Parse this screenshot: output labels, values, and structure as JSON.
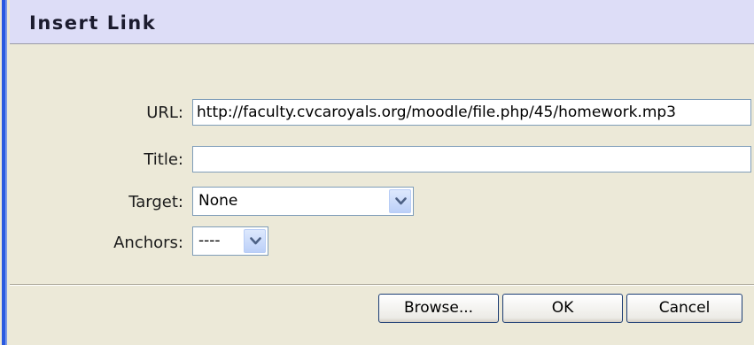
{
  "dialog": {
    "title": "Insert Link"
  },
  "form": {
    "url_label": "URL:",
    "url_value": "http://faculty.cvcaroyals.org/moodle/file.php/45/homework.mp3",
    "title_label": "Title:",
    "title_value": "",
    "target_label": "Target:",
    "target_value": "None",
    "anchors_label": "Anchors:",
    "anchors_value": "----"
  },
  "buttons": {
    "browse": "Browse...",
    "ok": "OK",
    "cancel": "Cancel"
  },
  "colors": {
    "title_bar": "#ddddf7",
    "dialog_bg": "#ece9d8",
    "input_border": "#7f9db9",
    "button_border": "#1c3d74"
  },
  "icons": {
    "dropdown": "chevron-down-icon"
  }
}
